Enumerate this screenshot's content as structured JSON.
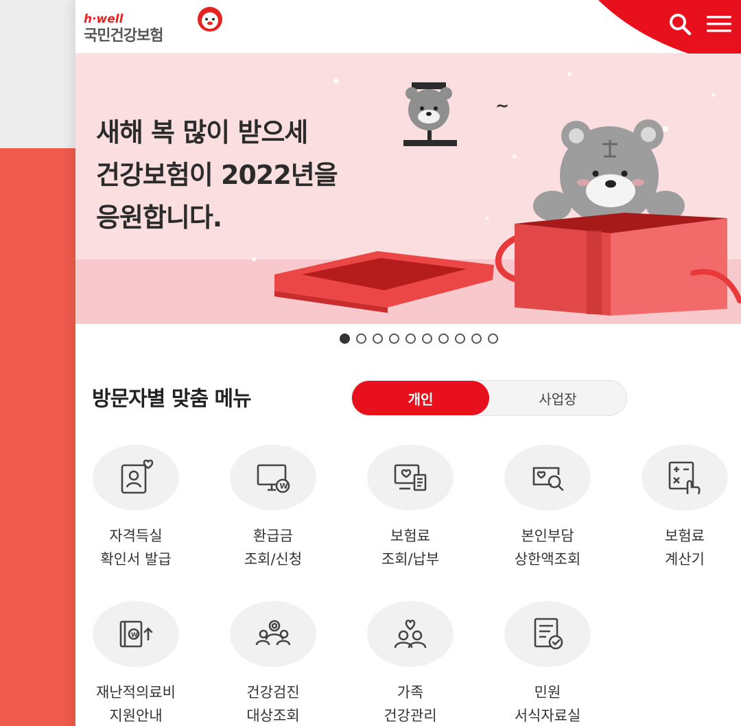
{
  "header": {
    "logo_small": "h·well",
    "logo_main": "국민건강보험",
    "icons": [
      "search-icon",
      "menu-icon"
    ]
  },
  "banner": {
    "line1": "새해 복 많이 받으세",
    "line2": "건강보험이 2022년을",
    "line3": "응원합니다.",
    "tilde": "~",
    "pager": {
      "total": 10,
      "active": 1
    }
  },
  "menu": {
    "title": "방문자별 맞춤 메뉴",
    "tabs": [
      {
        "label": "개인",
        "selected": true
      },
      {
        "label": "사업장",
        "selected": false
      }
    ],
    "items": [
      {
        "line1": "자격득실",
        "line2": "확인서 발급",
        "icon": "certificate-heart-icon"
      },
      {
        "line1": "환급금",
        "line2": "조회/신청",
        "icon": "monitor-coin-icon"
      },
      {
        "line1": "보험료",
        "line2": "조회/납부",
        "icon": "bill-payment-icon"
      },
      {
        "line1": "본인부담",
        "line2": "상한액조회",
        "icon": "search-card-icon"
      },
      {
        "line1": "보험료",
        "line2": "계산기",
        "icon": "calculator-icon"
      },
      {
        "line1": "재난적의료비",
        "line2": "지원안내",
        "icon": "medical-support-icon"
      },
      {
        "line1": "건강검진",
        "line2": "대상조회",
        "icon": "people-checkup-icon"
      },
      {
        "line1": "가족",
        "line2": "건강관리",
        "icon": "family-care-icon"
      },
      {
        "line1": "민원",
        "line2": "서식자료실",
        "icon": "document-form-icon"
      }
    ]
  },
  "colors": {
    "brand_red": "#e8101d",
    "banner_bg": "#fbdfe0",
    "side_red": "#ee5a4c"
  }
}
